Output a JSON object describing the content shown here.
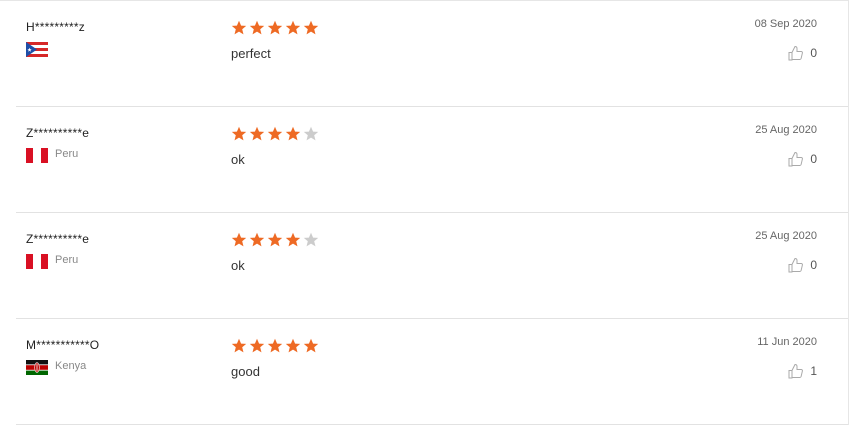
{
  "colors": {
    "star_filled": "#ee6a24",
    "star_empty": "#cccccc"
  },
  "reviews": [
    {
      "user": "H*********z",
      "country": "",
      "flag": "puerto-rico-flag",
      "rating": 5,
      "text": "perfect",
      "date": "08 Sep 2020",
      "likes": "0"
    },
    {
      "user": "Z**********e",
      "country": "Peru",
      "flag": "peru-flag",
      "rating": 4,
      "text": "ok",
      "date": "25 Aug 2020",
      "likes": "0"
    },
    {
      "user": "Z**********e",
      "country": "Peru",
      "flag": "peru-flag",
      "rating": 4,
      "text": "ok",
      "date": "25 Aug 2020",
      "likes": "0"
    },
    {
      "user": "M***********O",
      "country": "Kenya",
      "flag": "kenya-flag",
      "rating": 5,
      "text": "good",
      "date": "11 Jun 2020",
      "likes": "1"
    }
  ]
}
